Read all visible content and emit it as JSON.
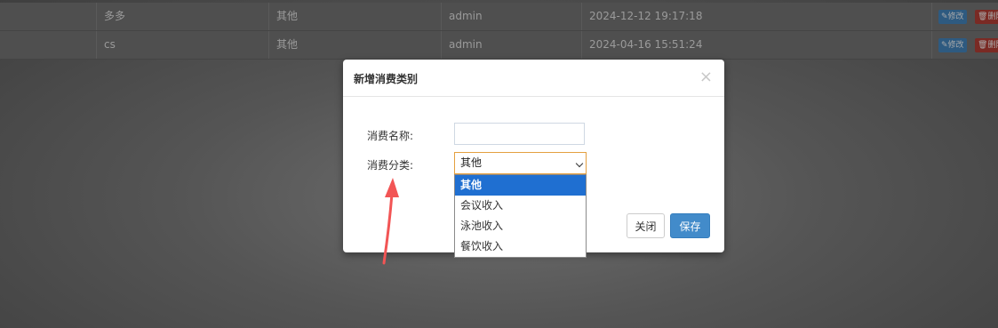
{
  "table": {
    "rows": [
      {
        "name": "多多",
        "category": "其他",
        "user": "admin",
        "time": "2024-12-12 19:17:18",
        "edit_label": "修改",
        "delete_label": "删除"
      },
      {
        "name": "cs",
        "category": "其他",
        "user": "admin",
        "time": "2024-04-16 15:51:24",
        "edit_label": "修改",
        "delete_label": "删除"
      }
    ]
  },
  "modal": {
    "title": "新增消费类别",
    "close_glyph": "×",
    "name_label": "消费名称:",
    "name_value": "",
    "category_label": "消费分类:",
    "category_selected": "其他",
    "category_options": [
      "其他",
      "会议收入",
      "泳池收入",
      "餐饮收入"
    ],
    "cancel_label": "关闭",
    "save_label": "保存"
  },
  "colors": {
    "primary": "#428bca",
    "selected_option": "#1f6fd1",
    "annotation_arrow": "#f25555"
  }
}
